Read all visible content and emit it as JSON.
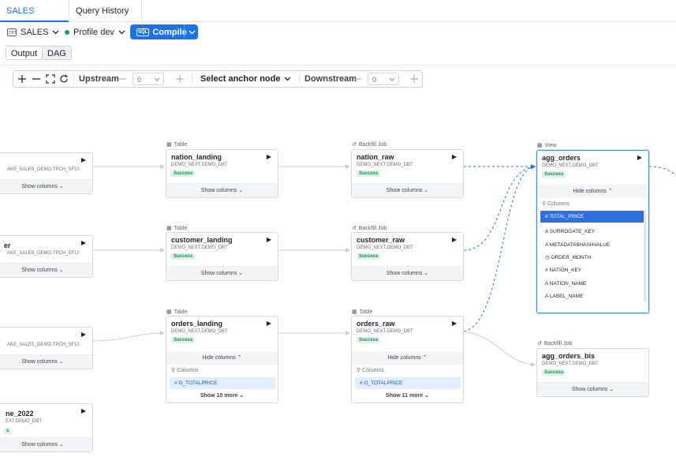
{
  "tabs": [
    {
      "label": "SALES",
      "active": true
    },
    {
      "label": "Query History",
      "active": false
    }
  ],
  "toolbar": {
    "project_label": "SALES",
    "profile_label": "Profile dev",
    "compile_label": "Compile",
    "output_label": "Output",
    "dag_label": "DAG"
  },
  "dag_controls": {
    "upstream_label": "Upstream",
    "upstream_value": "0",
    "anchor_label": "Select anchor node",
    "downstream_label": "Downstream",
    "downstream_value": "0"
  },
  "nodes": {
    "src1": {
      "path": "AKE_SALES_DEMO.TPCH_SF10",
      "footer": "Show columns"
    },
    "src2": {
      "name": "er",
      "path": "AKE_SALES_DEMO.TPCH_SF10",
      "footer": "Show columns"
    },
    "src3": {
      "path": "AKE_SALES_DEMO.TPCH_SF10",
      "footer": "Show columns"
    },
    "src4": {
      "name": "ne_2022",
      "path": "EXT.DEMO_DBT",
      "badge": "s",
      "footer": "Show columns"
    },
    "nation_landing": {
      "type": "Table",
      "name": "nation_landing",
      "path": "DEMO_NEXT.DEMO_DBT",
      "badge": "Success",
      "footer": "Show columns"
    },
    "customer_landing": {
      "type": "Table",
      "name": "customer_landing",
      "path": "DEMO_NEXT.DEMO_DBT",
      "badge": "Success",
      "footer": "Show columns"
    },
    "orders_landing": {
      "type": "Table",
      "name": "orders_landing",
      "path": "DEMO_NEXT.DEMO_DBT",
      "badge": "Success",
      "hide": "Hide columns",
      "search": "Columns",
      "col": "O_TOTALPRICE",
      "more": "Show 10 more"
    },
    "nation_raw": {
      "type": "Backfill Job",
      "name": "nation_raw",
      "path": "DEMO_NEXT.DEMO_DBT",
      "badge": "Success",
      "footer": "Show columns"
    },
    "customer_raw": {
      "type": "Backfill Job",
      "name": "customer_raw",
      "path": "DEMO_NEXT.DEMO_DBT",
      "badge": "Success",
      "footer": "Show columns"
    },
    "orders_raw": {
      "type": "Table",
      "name": "orders_raw",
      "path": "DEMO_NEXT.DEMO_DBT",
      "badge": "Success",
      "hide": "Hide columns",
      "search": "Columns",
      "col": "O_TOTALPRICE",
      "more": "Show 11 more"
    },
    "agg_orders": {
      "type": "View",
      "name": "agg_orders",
      "path": "DEMO_NEXT.DEMO_DBT",
      "badge": "Success",
      "hide": "Hide columns",
      "search": "Columns",
      "columns": [
        "TOTAL_PRICE",
        "SURROGATE_KEY",
        "METADATA$HASHVALUE",
        "ORDER_MONTH",
        "NATION_KEY",
        "NATION_NAME",
        "LABEL_NAME"
      ]
    },
    "agg_orders_bis": {
      "type": "Backfill Job",
      "name": "agg_orders_bis",
      "path": "DEMO_NEXT.DEMO_DBT",
      "badge": "Success",
      "footer": "Show columns"
    }
  },
  "colors": {
    "accent": "#1a73e8",
    "success": "#1a8f4d",
    "edge_dashed": "#2f6fde",
    "edge": "#c9cdd2"
  }
}
